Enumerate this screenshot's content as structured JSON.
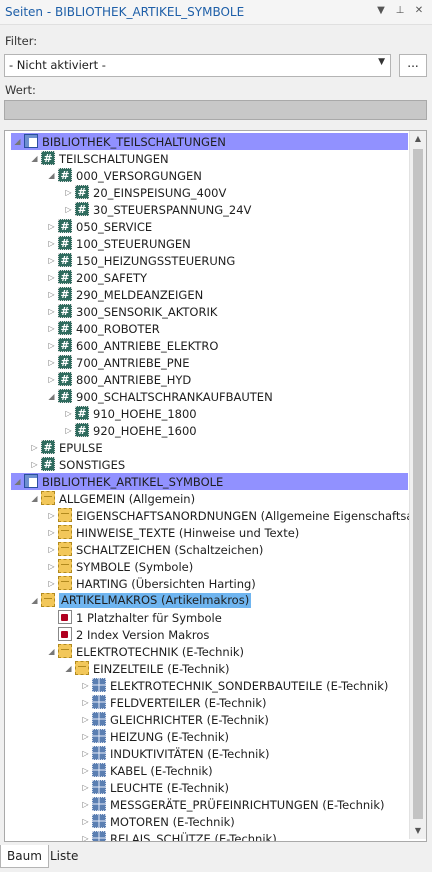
{
  "window": {
    "title": "Seiten - BIBLIOTHEK_ARTIKEL_SYMBOLE"
  },
  "filter": {
    "label": "Filter:",
    "value": "- Nicht aktiviert -",
    "browse_label": "..."
  },
  "wert": {
    "label": "Wert:"
  },
  "tree": [
    {
      "depth": 0,
      "icon": "grid",
      "exp": "◢",
      "label": "BIBLIOTHEK_TEILSCHALTUNGEN",
      "root": true
    },
    {
      "depth": 1,
      "icon": "hash",
      "exp": "◢",
      "label": "TEILSCHALTUNGEN"
    },
    {
      "depth": 2,
      "icon": "hash",
      "exp": "◢",
      "label": "000_VERSORGUNGEN"
    },
    {
      "depth": 3,
      "icon": "hash",
      "exp": "▷",
      "label": "20_EINSPEISUNG_400V"
    },
    {
      "depth": 3,
      "icon": "hash",
      "exp": "▷",
      "label": "30_STEUERSPANNUNG_24V"
    },
    {
      "depth": 2,
      "icon": "hash",
      "exp": "▷",
      "label": "050_SERVICE"
    },
    {
      "depth": 2,
      "icon": "hash",
      "exp": "▷",
      "label": "100_STEUERUNGEN"
    },
    {
      "depth": 2,
      "icon": "hash",
      "exp": "▷",
      "label": "150_HEIZUNGSSTEUERUNG"
    },
    {
      "depth": 2,
      "icon": "hash",
      "exp": "▷",
      "label": "200_SAFETY"
    },
    {
      "depth": 2,
      "icon": "hash",
      "exp": "▷",
      "label": "290_MELDEANZEIGEN"
    },
    {
      "depth": 2,
      "icon": "hash",
      "exp": "▷",
      "label": "300_SENSORIK_AKTORIK"
    },
    {
      "depth": 2,
      "icon": "hash",
      "exp": "▷",
      "label": "400_ROBOTER"
    },
    {
      "depth": 2,
      "icon": "hash",
      "exp": "▷",
      "label": "600_ANTRIEBE_ELEKTRO"
    },
    {
      "depth": 2,
      "icon": "hash",
      "exp": "▷",
      "label": "700_ANTRIEBE_PNE"
    },
    {
      "depth": 2,
      "icon": "hash",
      "exp": "▷",
      "label": "800_ANTRIEBE_HYD"
    },
    {
      "depth": 2,
      "icon": "hash",
      "exp": "◢",
      "label": "900_SCHALTSCHRANKAUFBAUTEN"
    },
    {
      "depth": 3,
      "icon": "hash",
      "exp": "▷",
      "label": "910_HOEHE_1800"
    },
    {
      "depth": 3,
      "icon": "hash",
      "exp": "▷",
      "label": "920_HOEHE_1600"
    },
    {
      "depth": 1,
      "icon": "hash",
      "exp": "▷",
      "label": "EPULSE"
    },
    {
      "depth": 1,
      "icon": "hash",
      "exp": "▷",
      "label": "SONSTIGES"
    },
    {
      "depth": 0,
      "icon": "grid",
      "exp": "◢",
      "label": "BIBLIOTHEK_ARTIKEL_SYMBOLE",
      "root": true
    },
    {
      "depth": 1,
      "icon": "folder",
      "exp": "◢",
      "label": "ALLGEMEIN (Allgemein)"
    },
    {
      "depth": 2,
      "icon": "folder",
      "exp": "▷",
      "label": "EIGENSCHAFTSANORDNUNGEN (Allgemeine Eigenschaftsa..."
    },
    {
      "depth": 2,
      "icon": "folder",
      "exp": "▷",
      "label": "HINWEISE_TEXTE (Hinweise und Texte)"
    },
    {
      "depth": 2,
      "icon": "folder",
      "exp": "▷",
      "label": "SCHALTZEICHEN (Schaltzeichen)"
    },
    {
      "depth": 2,
      "icon": "folder",
      "exp": "▷",
      "label": "SYMBOLE (Symbole)"
    },
    {
      "depth": 2,
      "icon": "folder",
      "exp": "▷",
      "label": "HARTING (Übersichten Harting)"
    },
    {
      "depth": 1,
      "icon": "folder",
      "exp": "◢",
      "label": "ARTIKELMAKROS (Artikelmakros)",
      "selected": true
    },
    {
      "depth": 2,
      "icon": "doc",
      "exp": "",
      "label": "1 Platzhalter für Symbole"
    },
    {
      "depth": 2,
      "icon": "doc",
      "exp": "",
      "label": "2 Index Version Makros"
    },
    {
      "depth": 2,
      "icon": "folder",
      "exp": "◢",
      "label": "ELEKTROTECHNIK (E-Technik)"
    },
    {
      "depth": 3,
      "icon": "folder",
      "exp": "◢",
      "label": "EINZELTEILE (E-Technik)"
    },
    {
      "depth": 4,
      "icon": "blue",
      "exp": "▷",
      "label": "ELEKTROTECHNIK_SONDERBAUTEILE (E-Technik)"
    },
    {
      "depth": 4,
      "icon": "blue",
      "exp": "▷",
      "label": "FELDVERTEILER (E-Technik)"
    },
    {
      "depth": 4,
      "icon": "blue",
      "exp": "▷",
      "label": "GLEICHRICHTER (E-Technik)"
    },
    {
      "depth": 4,
      "icon": "blue",
      "exp": "▷",
      "label": "HEIZUNG (E-Technik)"
    },
    {
      "depth": 4,
      "icon": "blue",
      "exp": "▷",
      "label": "INDUKTIVITÄTEN (E-Technik)"
    },
    {
      "depth": 4,
      "icon": "blue",
      "exp": "▷",
      "label": "KABEL (E-Technik)"
    },
    {
      "depth": 4,
      "icon": "blue",
      "exp": "▷",
      "label": "LEUCHTE (E-Technik)"
    },
    {
      "depth": 4,
      "icon": "blue",
      "exp": "▷",
      "label": "MESSGERÄTE_PRÜFEINRICHTUNGEN (E-Technik)"
    },
    {
      "depth": 4,
      "icon": "blue",
      "exp": "▷",
      "label": "MOTOREN (E-Technik)"
    },
    {
      "depth": 4,
      "icon": "blue",
      "exp": "▷",
      "label": "RELAIS_SCHÜTZE (E-Technik)"
    }
  ],
  "tabs": [
    {
      "label": "Baum",
      "active": true
    },
    {
      "label": "Liste",
      "active": false
    }
  ],
  "colors": {
    "root_highlight": "#9191ff",
    "selection": "#6fb5f0",
    "title": "#1e5fa8"
  }
}
